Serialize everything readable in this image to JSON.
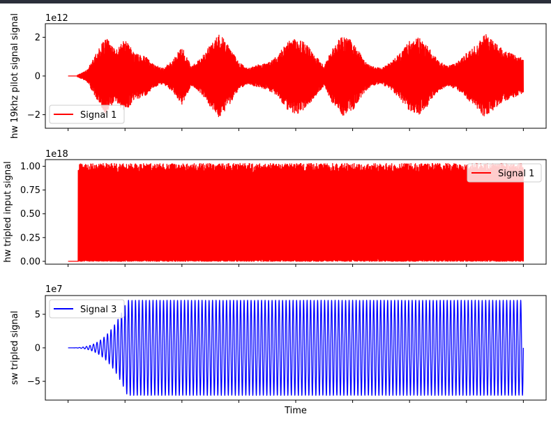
{
  "chart_data": [
    {
      "type": "line",
      "ylabel": "hw 19khz pilot signal signal",
      "offset_text": "1e12",
      "ylim": [
        -2.7,
        2.7
      ],
      "yticks": [
        -2,
        0,
        2
      ],
      "ytick_labels": [
        "−2",
        "0",
        "2"
      ],
      "xlim": [
        -0.05,
        1.05
      ],
      "xticks": [
        0,
        0.125,
        0.25,
        0.375,
        0.5,
        0.625,
        0.75,
        0.875,
        1
      ],
      "legend": {
        "entries": [
          "Signal 1"
        ],
        "placement": "lower-left"
      },
      "series": [
        {
          "name": "Signal 1",
          "color": "#ff0000",
          "x_range": [
            0,
            1
          ],
          "flat_until": 0.02,
          "envelope": [
            0,
            0.05,
            0.3,
            1.2,
            2.0,
            1.3,
            1.9,
            1.2,
            1.1,
            0.6,
            0.4,
            0.8,
            1.5,
            0.5,
            0.9,
            1.6,
            2.2,
            1.5,
            0.7,
            0.4,
            0.6,
            0.7,
            1.0,
            1.7,
            2.0,
            1.7,
            1.1,
            0.5,
            1.6,
            2.1,
            1.8,
            1.0,
            0.5,
            0.4,
            0.7,
            1.2,
            1.8,
            2.0,
            1.5,
            0.8,
            0.5,
            0.7,
            1.2,
            1.6,
            2.2,
            1.7,
            1.3,
            1.1,
            0.9
          ]
        }
      ]
    },
    {
      "type": "line",
      "ylabel": "hw tripled input signal",
      "offset_text": "1e18",
      "ylim": [
        -0.03,
        1.07
      ],
      "yticks": [
        0,
        0.25,
        0.5,
        0.75,
        1.0
      ],
      "ytick_labels": [
        "0.00",
        "0.25",
        "0.50",
        "0.75",
        "1.00"
      ],
      "xlim": [
        -0.05,
        1.05
      ],
      "xticks": [
        0,
        0.125,
        0.25,
        0.375,
        0.5,
        0.625,
        0.75,
        0.875,
        1
      ],
      "legend": {
        "entries": [
          "Signal 1"
        ],
        "placement": "upper-right"
      },
      "series": [
        {
          "name": "Signal 1",
          "color": "#ff0000",
          "x_range": [
            0,
            1
          ],
          "flat_until": 0.022,
          "max": 1.03
        }
      ]
    },
    {
      "type": "line",
      "ylabel": "sw tripled signal",
      "xlabel": "Time",
      "offset_text": "1e7",
      "ylim": [
        -7.8,
        7.8
      ],
      "yticks": [
        -5,
        0,
        5
      ],
      "ytick_labels": [
        "−5",
        "0",
        "5"
      ],
      "xlim": [
        -0.05,
        1.05
      ],
      "xticks": [
        0,
        0.125,
        0.25,
        0.375,
        0.5,
        0.625,
        0.75,
        0.875,
        1
      ],
      "legend": {
        "entries": [
          "Signal 3"
        ],
        "placement": "upper-left"
      },
      "series": [
        {
          "name": "Signal 3",
          "color": "#0000ff",
          "x_range": [
            0,
            1
          ],
          "amplitude": 7.1,
          "growth_end": 0.13,
          "cycles": 130
        }
      ]
    }
  ]
}
